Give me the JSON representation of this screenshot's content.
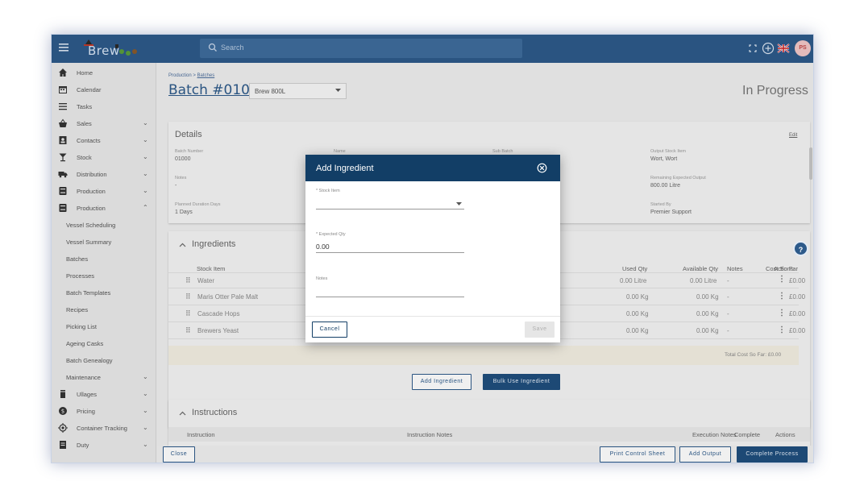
{
  "topbar": {
    "logo_text": "Brew",
    "search_placeholder": "Search",
    "avatar_initials": "PS"
  },
  "sidebar": {
    "items": [
      {
        "label": "Home",
        "icon": "home-icon",
        "chevron": ""
      },
      {
        "label": "Calendar",
        "icon": "calendar-icon",
        "chevron": ""
      },
      {
        "label": "Tasks",
        "icon": "list-icon",
        "chevron": ""
      },
      {
        "label": "Sales",
        "icon": "basket-icon",
        "chevron": "⌄"
      },
      {
        "label": "Contacts",
        "icon": "contacts-icon",
        "chevron": "⌄"
      },
      {
        "label": "Stock",
        "icon": "glass-icon",
        "chevron": "⌄"
      },
      {
        "label": "Distribution",
        "icon": "truck-icon",
        "chevron": "⌄"
      },
      {
        "label": "Production",
        "icon": "barrel-icon",
        "chevron": "⌄"
      },
      {
        "label": "Production",
        "icon": "barrel-icon",
        "chevron": "⌃"
      }
    ],
    "sub_items": [
      "Vessel Scheduling",
      "Vessel Summary",
      "Batches",
      "Processes",
      "Batch Templates",
      "Recipes",
      "Picking List",
      "Ageing Casks",
      "Batch Genealogy",
      "Maintenance"
    ],
    "maintenance_chevron": "⌄",
    "bottom_items": [
      {
        "label": "Ullages",
        "icon": "ullage-icon",
        "chevron": "⌄"
      },
      {
        "label": "Pricing",
        "icon": "pricing-icon",
        "chevron": "⌄"
      },
      {
        "label": "Container Tracking",
        "icon": "target-icon",
        "chevron": "⌄"
      },
      {
        "label": "Duty",
        "icon": "duty-icon",
        "chevron": "⌄"
      }
    ]
  },
  "header": {
    "breadcrumb_prefix": "Production > ",
    "breadcrumb_link": "Batches",
    "batch_title": "Batch #01000",
    "brew_select_value": "Brew 800L",
    "status": "In Progress"
  },
  "details": {
    "title": "Details",
    "edit_label": "Edit",
    "fields": {
      "batch_number_label": "Batch Number",
      "batch_number_value": "01000",
      "name_label": "Name",
      "sub_batch_label": "Sub Batch",
      "output_stock_label": "Output Stock Item",
      "output_stock_value": "Wort, Wort",
      "notes_label": "Notes",
      "notes_value": "-",
      "remaining_label": "Remaining Expected Output",
      "remaining_value": "800.00 Litre",
      "planned_label": "Planned Duration Days",
      "planned_value": "1 Days",
      "started_label": "Started By",
      "started_value": "Premier Support"
    }
  },
  "ingredients": {
    "title": "Ingredients",
    "headers": {
      "stock_item": "Stock Item",
      "used_qty": "Used Qty",
      "available_qty": "Available Qty",
      "notes": "Notes",
      "cost": "Cost So Far",
      "actions": "Actions"
    },
    "rows": [
      {
        "name": "Water",
        "used": "0.00 Litre",
        "available": "0.00 Litre",
        "notes": "-",
        "cost": "£0.00"
      },
      {
        "name": "Maris Otter Pale Malt",
        "used": "0.00 Kg",
        "available": "0.00 Kg",
        "notes": "-",
        "cost": "£0.00"
      },
      {
        "name": "Cascade Hops",
        "used": "0.00 Kg",
        "available": "0.00 Kg",
        "notes": "-",
        "cost": "£0.00"
      },
      {
        "name": "Brewers Yeast",
        "used": "0.00 Kg",
        "available": "0.00 Kg",
        "notes": "-",
        "cost": "£0.00"
      }
    ],
    "total_cost": "Total Cost So Far: £0.00",
    "add_button": "Add Ingredient",
    "bulk_button": "Bulk Use Ingredient"
  },
  "instructions": {
    "title": "Instructions",
    "headers": {
      "instruction": "Instruction",
      "instruction_notes": "Instruction Notes",
      "execution_notes": "Execution Notes",
      "complete": "Complete",
      "actions": "Actions"
    }
  },
  "footer": {
    "close": "Close",
    "print": "Print Control Sheet",
    "add_output": "Add Output",
    "complete": "Complete Process"
  },
  "dialog": {
    "title": "Add Ingredient",
    "stock_item_label": "* Stock Item",
    "stock_item_value": "",
    "expected_qty_label": "* Expected Qty",
    "expected_qty_value": "0.00",
    "notes_label": "Notes",
    "notes_value": "",
    "cancel": "Cancel",
    "save": "Save"
  },
  "colors": {
    "topbar": "#2d5a8a",
    "dialog_header": "#123e66",
    "primary_button": "#1f4e7d"
  }
}
